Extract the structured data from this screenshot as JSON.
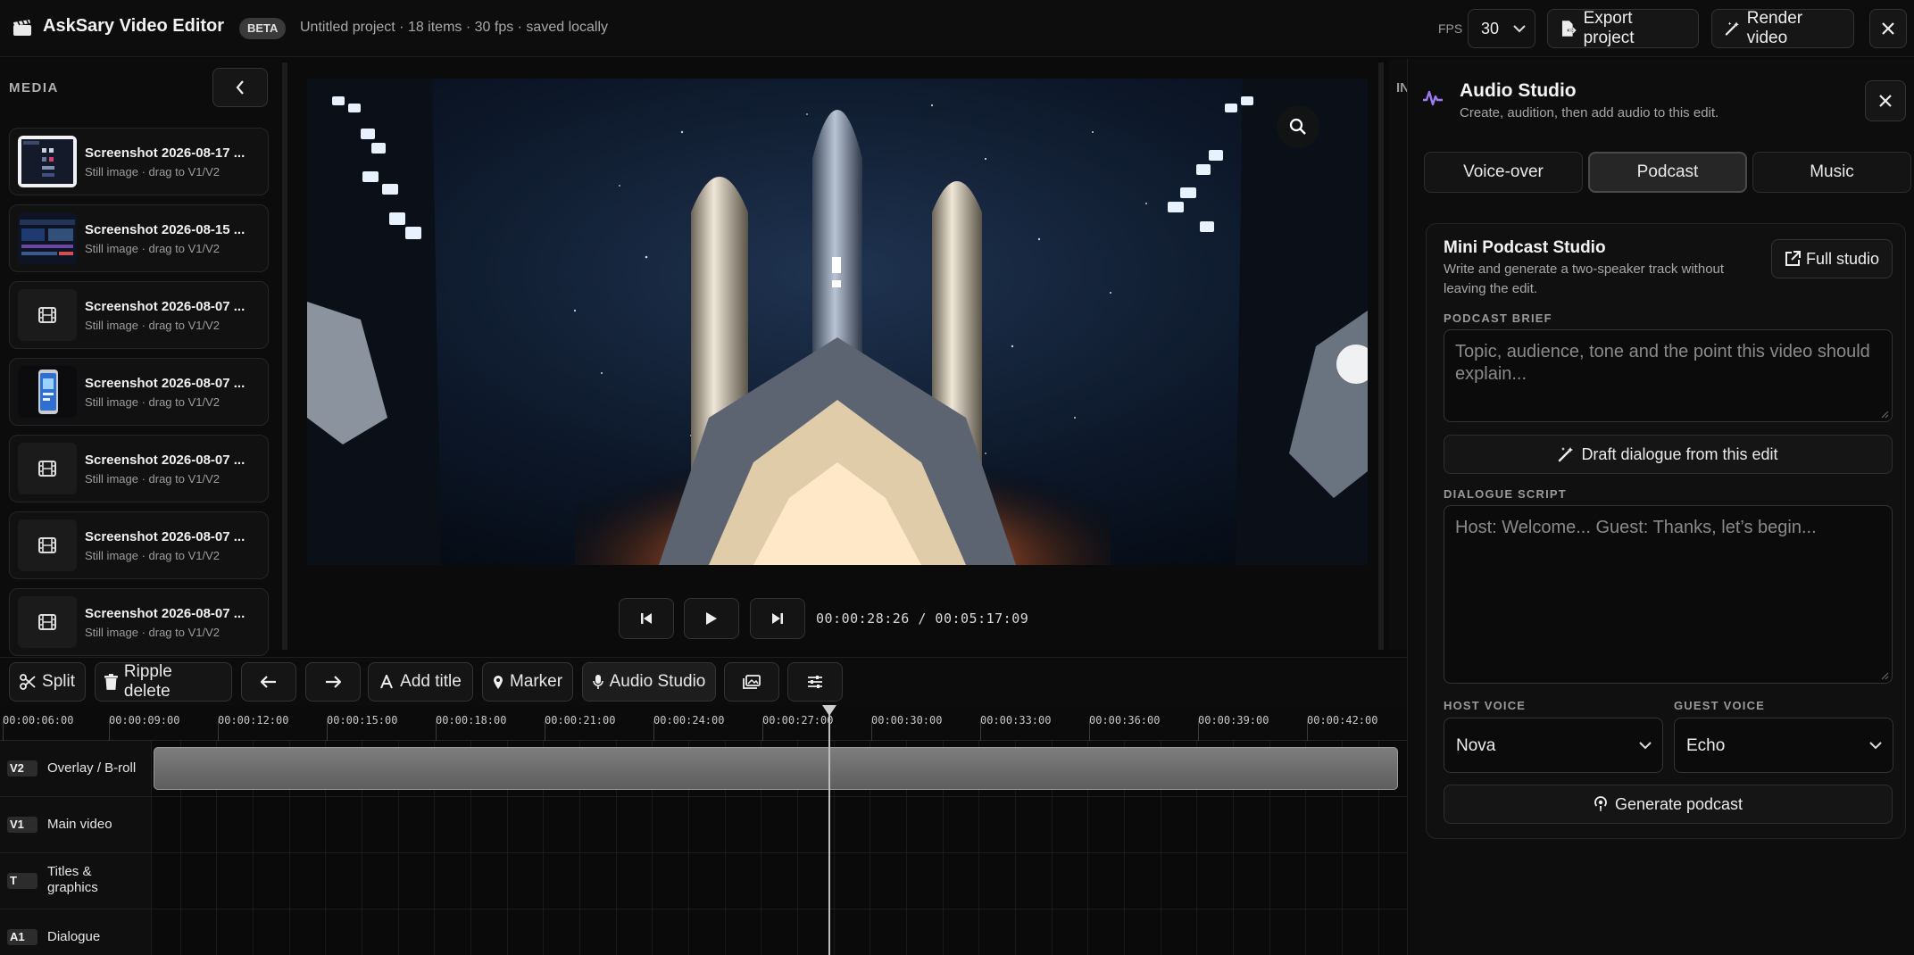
{
  "header": {
    "app_title": "AskSary Video Editor",
    "badge": "BETA",
    "project_meta": "Untitled project · 18 items · 30 fps · saved locally",
    "fps_label": "FPS",
    "fps_value": "30",
    "export_label": "Export project",
    "render_label": "Render video"
  },
  "media": {
    "title": "MEDIA",
    "items": [
      {
        "name": "Screenshot 2026-08-17 ...",
        "sub": "Still image · drag to V1/V2",
        "thumb": "screenshot"
      },
      {
        "name": "Screenshot 2026-08-15 ...",
        "sub": "Still image · drag to V1/V2",
        "thumb": "screenshot"
      },
      {
        "name": "Screenshot 2026-08-07 ...",
        "sub": "Still image · drag to V1/V2",
        "thumb": "film-icon"
      },
      {
        "name": "Screenshot 2026-08-07 ...",
        "sub": "Still image · drag to V1/V2",
        "thumb": "phone"
      },
      {
        "name": "Screenshot 2026-08-07 ...",
        "sub": "Still image · drag to V1/V2",
        "thumb": "film-icon"
      },
      {
        "name": "Screenshot 2026-08-07 ...",
        "sub": "Still image · drag to V1/V2",
        "thumb": "film-icon"
      },
      {
        "name": "Screenshot 2026-08-07 ...",
        "sub": "Still image · drag to V1/V2",
        "thumb": "film-icon"
      }
    ]
  },
  "preview": {
    "timecode": "00:00:28:26 / 00:05:17:09"
  },
  "inspector": {
    "tag": "IN"
  },
  "timeline": {
    "toolbar": {
      "split": "Split",
      "ripple_delete": "Ripple delete",
      "add_title": "Add title",
      "marker": "Marker",
      "audio_studio": "Audio Studio"
    },
    "ticks": [
      "00:00:06:00",
      "00:00:09:00",
      "00:00:12:00",
      "00:00:15:00",
      "00:00:18:00",
      "00:00:21:00",
      "00:00:24:00",
      "00:00:27:00",
      "00:00:30:00",
      "00:00:33:00",
      "00:00:36:00",
      "00:00:39:00",
      "00:00:42:00"
    ],
    "tracks": [
      {
        "tag": "V2",
        "name": "Overlay / B-roll"
      },
      {
        "tag": "V1",
        "name": "Main video"
      },
      {
        "tag": "T",
        "name": "Titles & graphics"
      },
      {
        "tag": "A1",
        "name": "Dialogue"
      }
    ]
  },
  "studio": {
    "title": "Audio Studio",
    "subtitle": "Create, audition, then add audio to this edit.",
    "tabs": [
      "Voice-over",
      "Podcast",
      "Music"
    ],
    "active_tab": "Podcast",
    "card": {
      "title": "Mini Podcast Studio",
      "description": "Write and generate a two-speaker track without leaving the edit.",
      "full_studio": "Full studio",
      "brief_label": "PODCAST BRIEF",
      "brief_placeholder": "Topic, audience, tone and the point this video should explain...",
      "draft_button": "Draft dialogue from this edit",
      "script_label": "DIALOGUE SCRIPT",
      "script_placeholder": "Host: Welcome... Guest: Thanks, let’s begin...",
      "host_label": "HOST VOICE",
      "host_value": "Nova",
      "guest_label": "GUEST VOICE",
      "guest_value": "Echo",
      "generate_button": "Generate podcast"
    }
  }
}
